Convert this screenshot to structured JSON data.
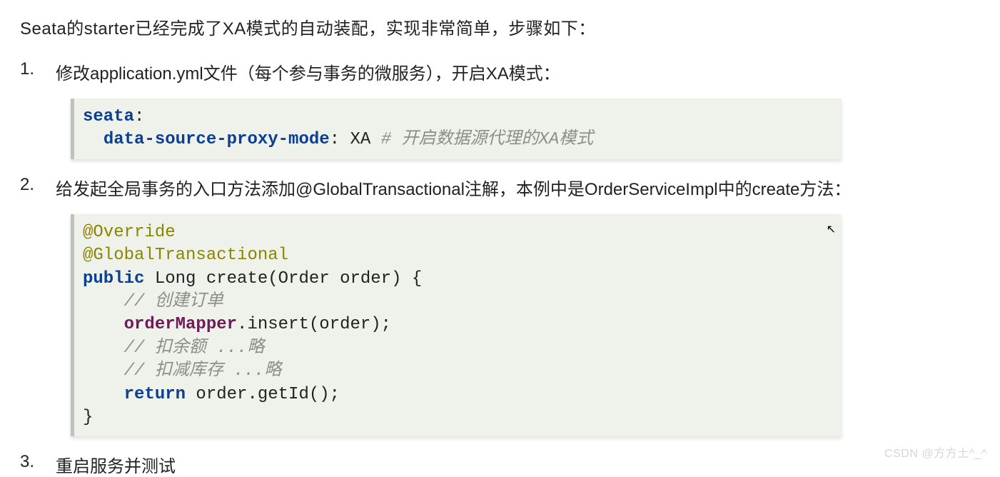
{
  "intro": "Seata的starter已经完成了XA模式的自动装配，实现非常简单，步骤如下：",
  "steps": [
    "修改application.yml文件（每个参与事务的微服务），开启XA模式：",
    "给发起全局事务的入口方法添加@GlobalTransactional注解，本例中是OrderServiceImpl中的create方法：",
    "重启服务并测试"
  ],
  "yaml": {
    "key1": "seata",
    "colon1": ":",
    "key2": "data-source-proxy-mode",
    "colon2": ":",
    "value": " XA ",
    "comment_marker": "# ",
    "comment": "开启数据源代理的XA模式"
  },
  "java": {
    "anno1": "@Override",
    "anno2": "@GlobalTransactional",
    "kw_public": "public",
    "sig_rest": " Long create(Order order) {",
    "c1": "// 创建订单",
    "field": "orderMapper",
    "insert_rest": ".insert(order);",
    "c2": "// 扣余额 ...略",
    "c3": "// 扣减库存 ...略",
    "kw_return": "return",
    "return_rest": " order.getId();",
    "close": "}"
  },
  "watermark": "CSDN @方方土^_^",
  "cursor_glyph": "↖"
}
